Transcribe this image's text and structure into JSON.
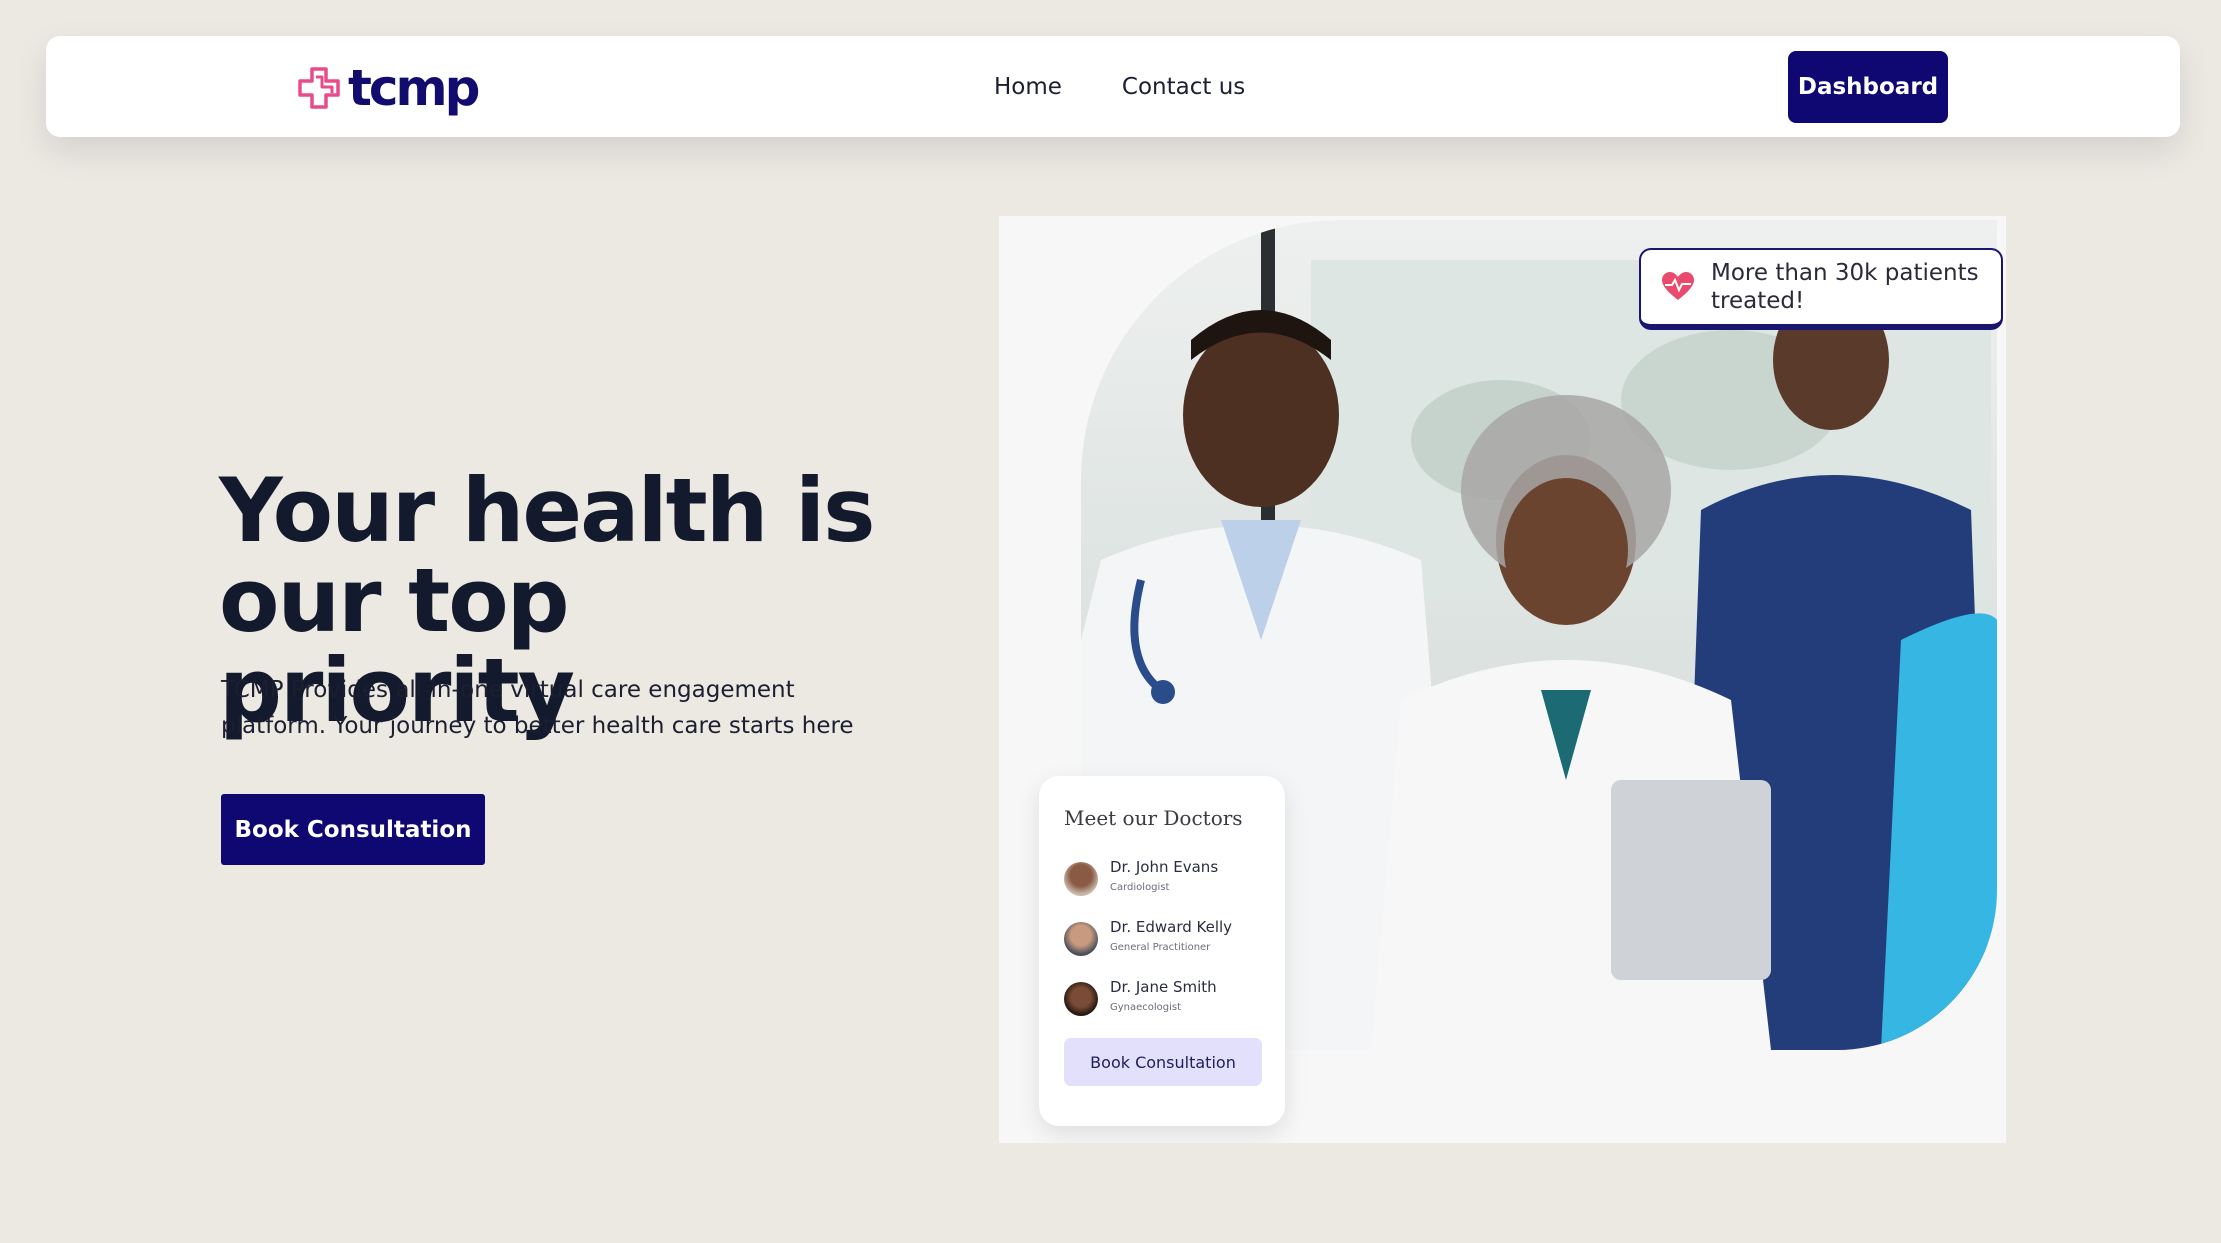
{
  "brand": {
    "name": "tcmp",
    "icon": "medical-cross-icon",
    "accent": "#e94b8a",
    "primary": "#0f0873"
  },
  "nav": {
    "links": [
      "Home",
      "Contact us"
    ],
    "dashboard_label": "Dashboard"
  },
  "hero": {
    "title_line1": "Your health is",
    "title_line2": "our top priority",
    "subtitle_line1": "TCMP Provides all-in-one virtual care engagement",
    "subtitle_line2": "platform. Your journey to better health care starts here",
    "cta_label": "Book Consultation"
  },
  "stat_card": {
    "icon": "heart-pulse-icon",
    "text_line1": "More than 30k patients",
    "text_line2": "treated!"
  },
  "doctors_card": {
    "title": "Meet our Doctors",
    "doctors": [
      {
        "name": "Dr. John Evans",
        "role": "Cardiologist"
      },
      {
        "name": "Dr. Edward Kelly",
        "role": "General Practitioner"
      },
      {
        "name": "Dr. Jane Smith",
        "role": "Gynaecologist"
      }
    ],
    "cta_label": "Book Consultation"
  }
}
